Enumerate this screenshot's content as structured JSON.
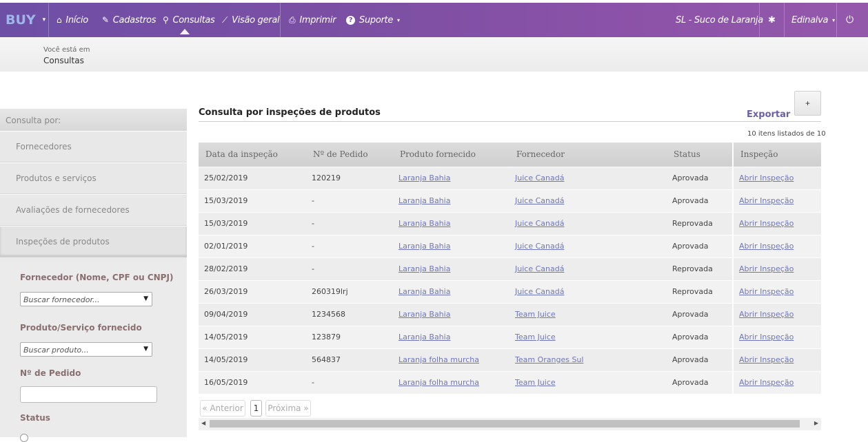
{
  "navbar": {
    "brand": "BUY",
    "items": [
      {
        "icon": "home-icon",
        "glyph": "⌂",
        "label": "Início"
      },
      {
        "icon": "pencil-icon",
        "glyph": "✎",
        "label": "Cadastros"
      },
      {
        "icon": "search-icon",
        "glyph": "⚲",
        "label": "Consultas"
      },
      {
        "icon": "chart-line-icon",
        "glyph": "⟋",
        "label": "Visão geral"
      },
      {
        "icon": "printer-icon",
        "glyph": "⎙",
        "label": "Imprimir"
      },
      {
        "icon": "help-icon",
        "glyph": "?",
        "label": "Suporte"
      }
    ],
    "company": "SL - Suco de Laranja",
    "user": "Edinalva",
    "settings_glyph": "✱",
    "power_glyph": "⏻"
  },
  "breadcrumb": {
    "prefix": "Você está em",
    "current": "Consultas"
  },
  "sidebar": {
    "header": "Consulta por:",
    "items": [
      "Fornecedores",
      "Produtos e serviços",
      "Avaliações de fornecedores",
      "Inspeções de produtos"
    ],
    "filters": {
      "supplier_label": "Fornecedor (Nome, CPF ou CNPJ)",
      "supplier_placeholder": "Buscar fornecedor...",
      "product_label": "Produto/Serviço fornecido",
      "product_placeholder": "Buscar produto...",
      "order_label": "Nº de Pedido",
      "order_value": "",
      "status_label": "Status"
    }
  },
  "main": {
    "title": "Consulta por inspeções de produtos",
    "export_label": "Exportar",
    "add_label": "+",
    "count_text": "10 itens listados de 10",
    "columns": [
      "Data da inspeção",
      "Nº de Pedido",
      "Produto fornecido",
      "Fornecedor",
      "Status",
      "Inspeção"
    ],
    "rows": [
      [
        "25/02/2019",
        "120219",
        "Laranja Bahia",
        "Juice Canadá",
        "Aprovada",
        "Abrir Inspeção"
      ],
      [
        "15/03/2019",
        "-",
        "Laranja Bahia",
        "Juice Canadá",
        "Aprovada",
        "Abrir Inspeção"
      ],
      [
        "15/03/2019",
        "-",
        "Laranja Bahia",
        "Juice Canadá",
        "Reprovada",
        "Abrir Inspeção"
      ],
      [
        "02/01/2019",
        "-",
        "Laranja Bahia",
        "Juice Canadá",
        "Aprovada",
        "Abrir Inspeção"
      ],
      [
        "28/02/2019",
        "-",
        "Laranja Bahia",
        "Juice Canadá",
        "Reprovada",
        "Abrir Inspeção"
      ],
      [
        "26/03/2019",
        "260319lrj",
        "Laranja Bahia",
        "Juice Canadá",
        "Reprovada",
        "Abrir Inspeção"
      ],
      [
        "09/04/2019",
        "1234568",
        "Laranja Bahia",
        "Team Juice",
        "Aprovada",
        "Abrir Inspeção"
      ],
      [
        "14/05/2019",
        "123879",
        "Laranja Bahia",
        "Team Juice",
        "Aprovada",
        "Abrir Inspeção"
      ],
      [
        "14/05/2019",
        "564837",
        "Laranja folha murcha",
        "Team Oranges Sul",
        "Aprovada",
        "Abrir Inspeção"
      ],
      [
        "16/05/2019",
        "-",
        "Laranja folha murcha",
        "Team Juice",
        "Aprovada",
        "Abrir Inspeção"
      ]
    ],
    "pagination": {
      "prev": "« Anterior",
      "page": "1",
      "next": "Próxima »"
    }
  }
}
